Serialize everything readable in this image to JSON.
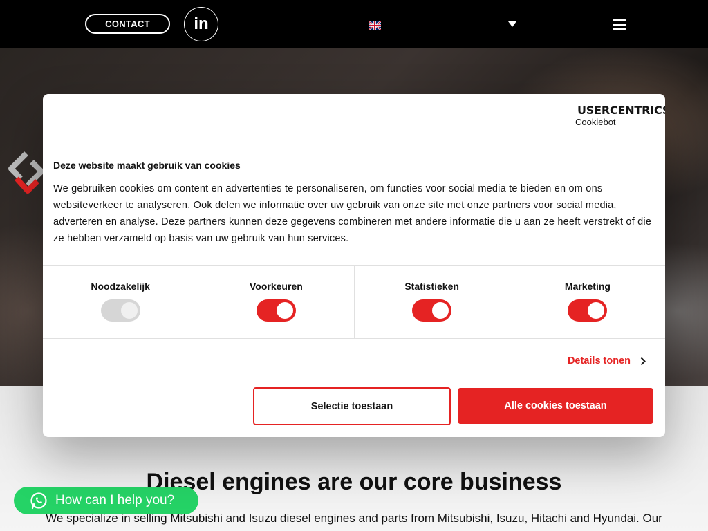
{
  "header": {
    "contact_label": "CONTACT",
    "linkedin_label": "in",
    "language_flag": "uk-flag-icon",
    "menu_icon": "hamburger-menu-icon"
  },
  "hero": {
    "logo_icon": "brand-logo-icon"
  },
  "cookie_dialog": {
    "brand_name": "USERCENTRICS",
    "brand_sub": "Cookiebot",
    "title": "Deze website maakt gebruik van cookies",
    "text": "We gebruiken cookies om content en advertenties te personaliseren, om functies voor social media te bieden en om ons websiteverkeer te analyseren. Ook delen we informatie over uw gebruik van onze site met onze partners voor social media, adverteren en analyse. Deze partners kunnen deze gegevens combineren met andere informatie die u aan ze heeft verstrekt of die ze hebben verzameld op basis van uw gebruik van hun services.",
    "toggles": [
      {
        "label": "Noodzakelijk",
        "state": "on",
        "disabled": true
      },
      {
        "label": "Voorkeuren",
        "state": "on"
      },
      {
        "label": "Statistieken",
        "state": "on"
      },
      {
        "label": "Marketing",
        "state": "on"
      }
    ],
    "details_label": "Details tonen",
    "select_label": "Selectie toestaan",
    "allow_all_label": "Alle cookies toestaan",
    "accent_color": "#e52323"
  },
  "main": {
    "headline": "Diesel engines are our core business",
    "subtext": "We specialize in selling Mitsubishi and Isuzu diesel engines and parts from Mitsubishi, Isuzu, Hitachi and Hyundai. Our"
  },
  "whatsapp": {
    "label": "How can I help you?",
    "color": "#25d366"
  }
}
